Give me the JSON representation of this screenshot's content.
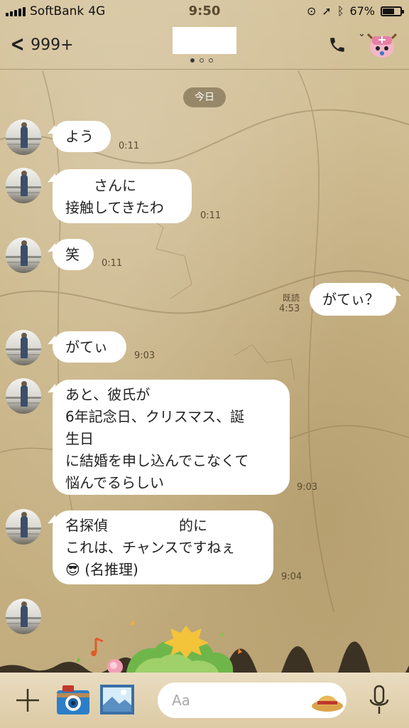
{
  "status_bar": {
    "carrier": "SoftBank",
    "network": "4G",
    "time": "9:50",
    "battery": "67%",
    "battery_level": 0.67
  },
  "header": {
    "back_count": "999+",
    "page_dots": 3,
    "active_dot": 0
  },
  "date_separator": "今日",
  "messages": [
    {
      "side": "in",
      "text": "よう",
      "time": "0:11"
    },
    {
      "side": "in",
      "text": "　　さんに\n接触してきたわ",
      "time": "0:11"
    },
    {
      "side": "in",
      "text": "笑",
      "time": "0:11"
    },
    {
      "side": "out",
      "text": "がてぃ？",
      "time": "4:53",
      "read": "既読"
    },
    {
      "side": "in",
      "text": "がてぃ",
      "time": "9:03"
    },
    {
      "side": "in",
      "text": "あと、彼氏が\n6年記念日、クリスマス、誕\n生日\nに結婚を申し込んでこなくて\n悩んでるらしい",
      "time": "9:03"
    },
    {
      "side": "in",
      "text": "名探偵　　　　　的に\nこれは、チャンスですねぇ\n😎 (名推理)",
      "time": "9:04"
    }
  ],
  "input": {
    "placeholder": "Aa"
  },
  "icons": {
    "back": "chevron-left-icon",
    "call": "phone-icon",
    "profile": "chopper-avatar-icon",
    "add": "plus-icon",
    "camera": "camera-icon",
    "gallery": "photo-icon",
    "sticker": "straw-hat-icon",
    "voice": "microphone-icon"
  }
}
